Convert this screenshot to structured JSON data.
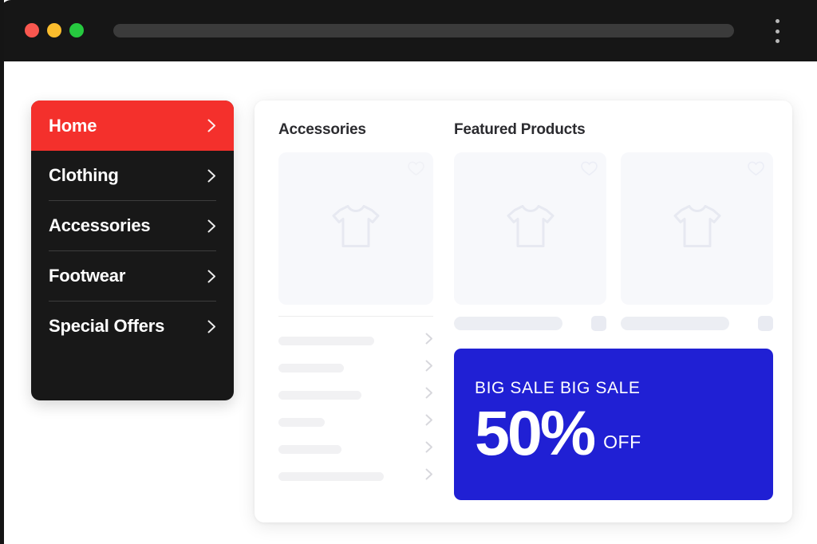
{
  "browser": {
    "traffic_lights": [
      {
        "name": "close",
        "color": "#f9574f"
      },
      {
        "name": "minimize",
        "color": "#fbbd2d"
      },
      {
        "name": "maximize",
        "color": "#26c93f"
      }
    ],
    "address_value": "",
    "address_placeholder": "",
    "menu_icon": "kebab-menu-icon"
  },
  "sidebar": {
    "items": [
      {
        "label": "Home",
        "active": true,
        "chevron": "chevron-right-icon"
      },
      {
        "label": "Clothing",
        "active": false,
        "chevron": "chevron-right-icon"
      },
      {
        "label": "Accessories",
        "active": false,
        "chevron": "chevron-right-icon"
      },
      {
        "label": "Footwear",
        "active": false,
        "chevron": "chevron-right-icon"
      },
      {
        "label": "Special Offers",
        "active": false,
        "chevron": "chevron-right-icon"
      }
    ]
  },
  "content": {
    "left": {
      "title": "Accessories",
      "card": {
        "icon": "tshirt-icon",
        "corner_icon": "heart-icon"
      },
      "list_rows": [
        {
          "width": 120
        },
        {
          "width": 82
        },
        {
          "width": 104
        },
        {
          "width": 58
        },
        {
          "width": 79
        },
        {
          "width": 132
        }
      ],
      "row_chevron": "chevron-right-icon"
    },
    "right": {
      "title": "Featured Products",
      "cards": [
        {
          "icon": "tshirt-icon",
          "corner_icon": "heart-icon",
          "meta_bar_width": 136,
          "meta_button": "cart-button"
        },
        {
          "icon": "tshirt-icon",
          "corner_icon": "heart-icon",
          "meta_bar_width": 136,
          "meta_button": "cart-button"
        }
      ],
      "banner": {
        "kicker": "BIG SALE BIG SALE",
        "percent": "50%",
        "off": "OFF",
        "background": "#2020d4"
      }
    }
  },
  "colors": {
    "accent_red": "#f4302c",
    "sidebar_dark": "#181818",
    "banner_blue": "#2020d4",
    "chrome_dark": "#161616"
  }
}
